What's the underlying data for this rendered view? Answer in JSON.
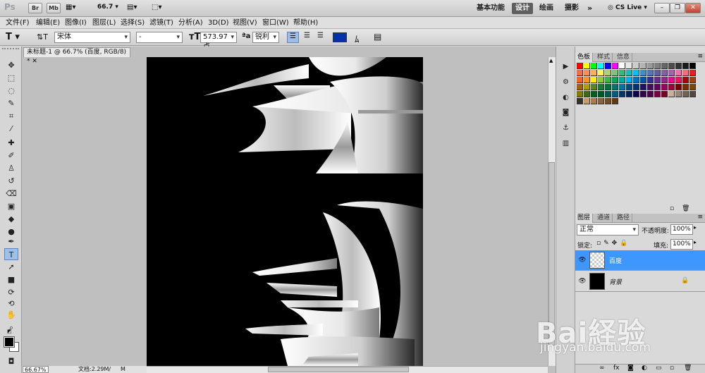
{
  "app": {
    "logo": "Ps",
    "badges": [
      "Br",
      "Mb"
    ],
    "zoom": "66.7"
  },
  "workspaces": [
    "基本功能",
    "设计",
    "绘画",
    "摄影"
  ],
  "active_workspace": "设计",
  "cslive": "CS Live",
  "menus": [
    "文件(F)",
    "编辑(E)",
    "图像(I)",
    "图层(L)",
    "选择(S)",
    "滤镜(T)",
    "分析(A)",
    "3D(D)",
    "视图(V)",
    "窗口(W)",
    "帮助(H)"
  ],
  "options": {
    "font": "宋体",
    "style": "-",
    "size": "573.97 点",
    "aa_label": "a",
    "aa": "锐利",
    "color": "#0033aa"
  },
  "document": {
    "tab": "未标题-1 @ 66.7% (百度, RGB/8) *",
    "zoom_status": "66.67%",
    "doc_status": "文档:2.29M/",
    "doc_status_tail": "M"
  },
  "swatch_panel": {
    "tabs": [
      "色板",
      "样式",
      "信息"
    ]
  },
  "layers_panel": {
    "tabs": [
      "图层",
      "通道",
      "路径"
    ],
    "blend": "正常",
    "opacity_label": "不透明度:",
    "opacity": "100%",
    "lock_label": "锁定:",
    "fill_label": "填充:",
    "fill": "100%",
    "layers": [
      {
        "name": "百度",
        "selected": true
      },
      {
        "name": "背景",
        "selected": false
      }
    ]
  },
  "watermark": {
    "brand": "Bai経验",
    "url": "jingyan.baidu.com"
  },
  "swatch_colors": [
    "#ff0000",
    "#ffff00",
    "#00ff00",
    "#00ffff",
    "#0000ff",
    "#ff00ff",
    "#ffffff",
    "#e6e6e6",
    "#cccccc",
    "#b3b3b3",
    "#999999",
    "#808080",
    "#666666",
    "#4d4d4d",
    "#333333",
    "#1a1a1a",
    "#000000",
    "#f26c4f",
    "#f68e55",
    "#fbaf5c",
    "#fff467",
    "#acd372",
    "#7cc576",
    "#3bb878",
    "#1abbb4",
    "#00bff3",
    "#438ccb",
    "#5574b9",
    "#605ca8",
    "#855fa8",
    "#a763a8",
    "#f06ea9",
    "#f26d7d",
    "#ed1c24",
    "#f26522",
    "#f7941d",
    "#fff200",
    "#8dc63f",
    "#39b54a",
    "#00a651",
    "#00a99d",
    "#00aeef",
    "#0072bc",
    "#0054a6",
    "#2e3192",
    "#662d91",
    "#92278f",
    "#ec008c",
    "#ed145b",
    "#9e0b0f",
    "#a0410d",
    "#a3620a",
    "#aba000",
    "#598527",
    "#197b30",
    "#007236",
    "#00746b",
    "#0076a3",
    "#004b80",
    "#003471",
    "#1b1464",
    "#440e62",
    "#630460",
    "#9e005d",
    "#9e0039",
    "#790000",
    "#7b2e00",
    "#7d4900",
    "#827b00",
    "#406618",
    "#005e20",
    "#005826",
    "#005952",
    "#005b7f",
    "#003663",
    "#002157",
    "#0d004c",
    "#32004b",
    "#4b0049",
    "#7b0046",
    "#7a0026",
    "#c7b299",
    "#998675",
    "#736357",
    "#534741",
    "#37302a",
    "#c69c6d",
    "#a67c52",
    "#8c6239",
    "#754c24",
    "#603913"
  ]
}
